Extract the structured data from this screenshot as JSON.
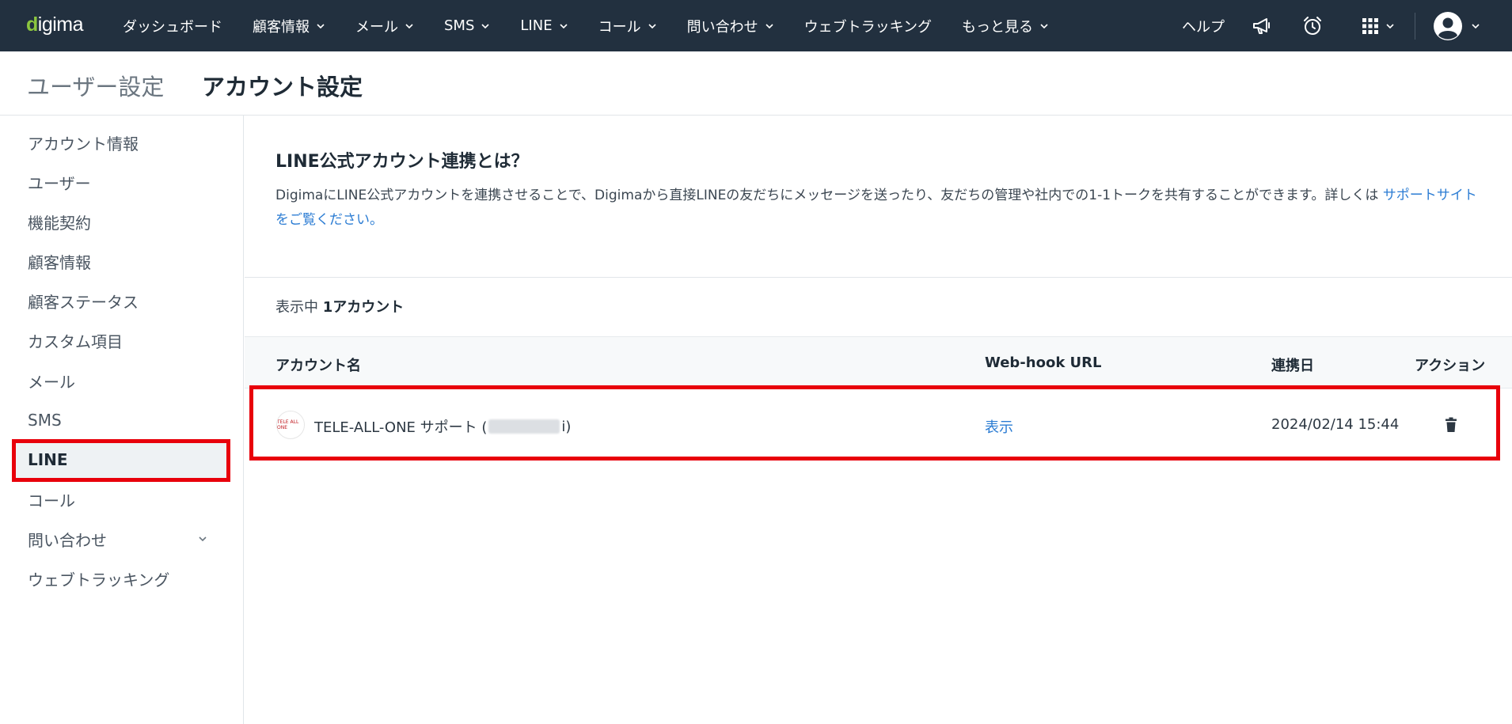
{
  "navbar": {
    "logo": "digima",
    "items": [
      {
        "label": "ダッシュボード",
        "dropdown": false
      },
      {
        "label": "顧客情報",
        "dropdown": true
      },
      {
        "label": "メール",
        "dropdown": true
      },
      {
        "label": "SMS",
        "dropdown": true
      },
      {
        "label": "LINE",
        "dropdown": true
      },
      {
        "label": "コール",
        "dropdown": true
      },
      {
        "label": "問い合わせ",
        "dropdown": true
      },
      {
        "label": "ウェブトラッキング",
        "dropdown": false
      },
      {
        "label": "もっと見る",
        "dropdown": true
      }
    ],
    "help_label": "ヘルプ",
    "icons": [
      "megaphone-icon",
      "alarm-clock-icon",
      "apps-grid-icon",
      "user-avatar-icon"
    ]
  },
  "header": {
    "parent": "ユーザー設定",
    "current": "アカウント設定"
  },
  "sidebar": {
    "items": [
      {
        "label": "アカウント情報"
      },
      {
        "label": "ユーザー"
      },
      {
        "label": "機能契約"
      },
      {
        "label": "顧客情報"
      },
      {
        "label": "顧客ステータス"
      },
      {
        "label": "カスタム項目"
      },
      {
        "label": "メール"
      },
      {
        "label": "SMS"
      },
      {
        "label": "LINE"
      },
      {
        "label": "コール"
      },
      {
        "label": "問い合わせ"
      },
      {
        "label": "ウェブトラッキング"
      }
    ],
    "active": "LINE"
  },
  "main": {
    "info_title": "LINE公式アカウント連携とは？",
    "info_desc": "DigimaにLINE公式アカウントを連携させることで、Digimaから直接LINEの友だちにメッセージを送ったり、友だちの管理や社内での1-1トークを共有することができます。詳しくは ",
    "info_link": "サポートサイトをご覧ください。",
    "count_prefix": "表示中",
    "count_value": "1アカウント",
    "table": {
      "headers": [
        "アカウント名",
        "Web-hook URL",
        "連携日",
        "アクション"
      ],
      "rows": [
        {
          "account_name_prefix": "TELE-ALL-ONE サポート (",
          "account_name_suffix": "i)",
          "avatar_text": "TELE ALL ONE",
          "webhook": "表示",
          "linked_date": "2024/02/14 15:44"
        }
      ]
    }
  },
  "colors": {
    "navbar": "#22303f",
    "link": "#2b7cd3",
    "highlight": "#e8000b",
    "logo_accent": "#8cc63f"
  }
}
